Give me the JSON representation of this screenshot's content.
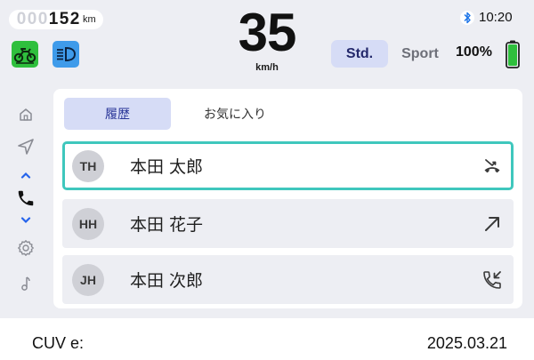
{
  "status": {
    "odometer_digits": [
      "0",
      "0",
      "0",
      "1",
      "5",
      "2"
    ],
    "odometer_dim_count": 3,
    "odometer_unit": "km",
    "speed": "35",
    "speed_unit": "km/h",
    "mode_std": "Std.",
    "mode_sport": "Sport",
    "battery_percent": "100%",
    "battery_level": 1.0,
    "time": "10:20",
    "indicators": [
      "traction-control-icon",
      "headlight-icon"
    ],
    "bluetooth": "bluetooth-icon"
  },
  "nav": {
    "items": [
      "home-icon",
      "navigation-icon",
      "chevron-up-icon",
      "phone-icon",
      "chevron-down-icon",
      "settings-icon",
      "music-icon"
    ],
    "active": "phone-icon"
  },
  "tabs": {
    "history": "履歴",
    "favorites": "お気に入り",
    "active": "history"
  },
  "contacts": [
    {
      "initials": "TH",
      "name": "本田 太郎",
      "call_type": "missed-call-icon",
      "selected": true
    },
    {
      "initials": "HH",
      "name": "本田 花子",
      "call_type": "outgoing-call-icon",
      "selected": false
    },
    {
      "initials": "JH",
      "name": "本田 次郎",
      "call_type": "incoming-call-icon",
      "selected": false
    }
  ],
  "footer": {
    "model": "CUV e:",
    "date": "2025.03.21"
  },
  "colors": {
    "accent_blue": "#2b3799",
    "selection": "#3fc7bd",
    "indicator_green": "#2fbf3d",
    "indicator_blue": "#3f9bea",
    "battery_green": "#2fbf3d",
    "nav_arrow": "#2563eb"
  }
}
